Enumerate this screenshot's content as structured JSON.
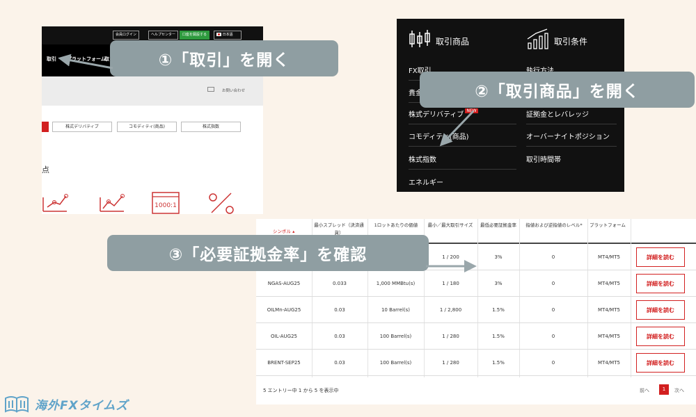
{
  "shot1": {
    "top_buttons": [
      "会員ログイン",
      "ヘルプセンター",
      "口座を開設する",
      "日本語"
    ],
    "nav": [
      "取引",
      "プラットフォーム",
      "取"
    ],
    "contact": "お問い合わせ",
    "tabs": [
      "株式デリバティブ",
      "コモディティ(商品)",
      "株式指数"
    ],
    "point_char": "点",
    "leverage_icon_text": "1000:1",
    "percent_symbol": "%"
  },
  "shot2": {
    "col1_head": "取引商品",
    "col2_head": "取引条件",
    "col1_items": [
      "FX取引",
      "貴金属",
      "株式デリバティブ",
      "コモディティ(商品)",
      "株式指数",
      "エネルギー"
    ],
    "col2_items": [
      "執行方法",
      "証拠金とレバレッジ",
      "オーバーナイトポジション",
      "取引時間帯"
    ],
    "new_badge": "NEW"
  },
  "table": {
    "headers": [
      "シンボル",
      "最小スプレッド（決済通貨）",
      "1ロットあたりの価値",
      "最小／最大取引サイズ",
      "最低必要証拠金率",
      "指値および逆指値のレベル*",
      "プラットフォーム"
    ],
    "rows": [
      {
        "symbol": "",
        "spread": "",
        "lot": "",
        "size": "1 / 200",
        "margin": "3%",
        "level": "0",
        "platform": "MT4/MT5",
        "detail": "詳細を読む"
      },
      {
        "symbol": "NGAS-AUG25",
        "spread": "0.033",
        "lot": "1,000 MMBtu(s)",
        "size": "1 / 180",
        "margin": "3%",
        "level": "0",
        "platform": "MT4/MT5",
        "detail": "詳細を読む"
      },
      {
        "symbol": "OILMn-AUG25",
        "spread": "0.03",
        "lot": "10 Barrel(s)",
        "size": "1 / 2,800",
        "margin": "1.5%",
        "level": "0",
        "platform": "MT4/MT5",
        "detail": "詳細を読む"
      },
      {
        "symbol": "OIL-AUG25",
        "spread": "0.03",
        "lot": "100 Barrel(s)",
        "size": "1 / 280",
        "margin": "1.5%",
        "level": "0",
        "platform": "MT4/MT5",
        "detail": "詳細を読む"
      },
      {
        "symbol": "BRENT-SEP25",
        "spread": "0.03",
        "lot": "100 Barrel(s)",
        "size": "1 / 280",
        "margin": "1.5%",
        "level": "0",
        "platform": "MT4/MT5",
        "detail": "詳細を読む"
      }
    ],
    "footer": "5 エントリー中 1 から 5 を表示中",
    "prev": "前へ",
    "page": "1",
    "next": "次へ"
  },
  "callouts": {
    "c1": "①「取引」を開く",
    "c2": "②「取引商品」を開く",
    "c3": "③「必要証拠金率」を確認"
  },
  "logo": {
    "text": "海外FXタイムズ"
  },
  "colors": {
    "background": "#fbf3ea",
    "callout": "#8f9ea2",
    "accent_red": "#d21f1f",
    "logo_blue": "#5fa3c9"
  }
}
